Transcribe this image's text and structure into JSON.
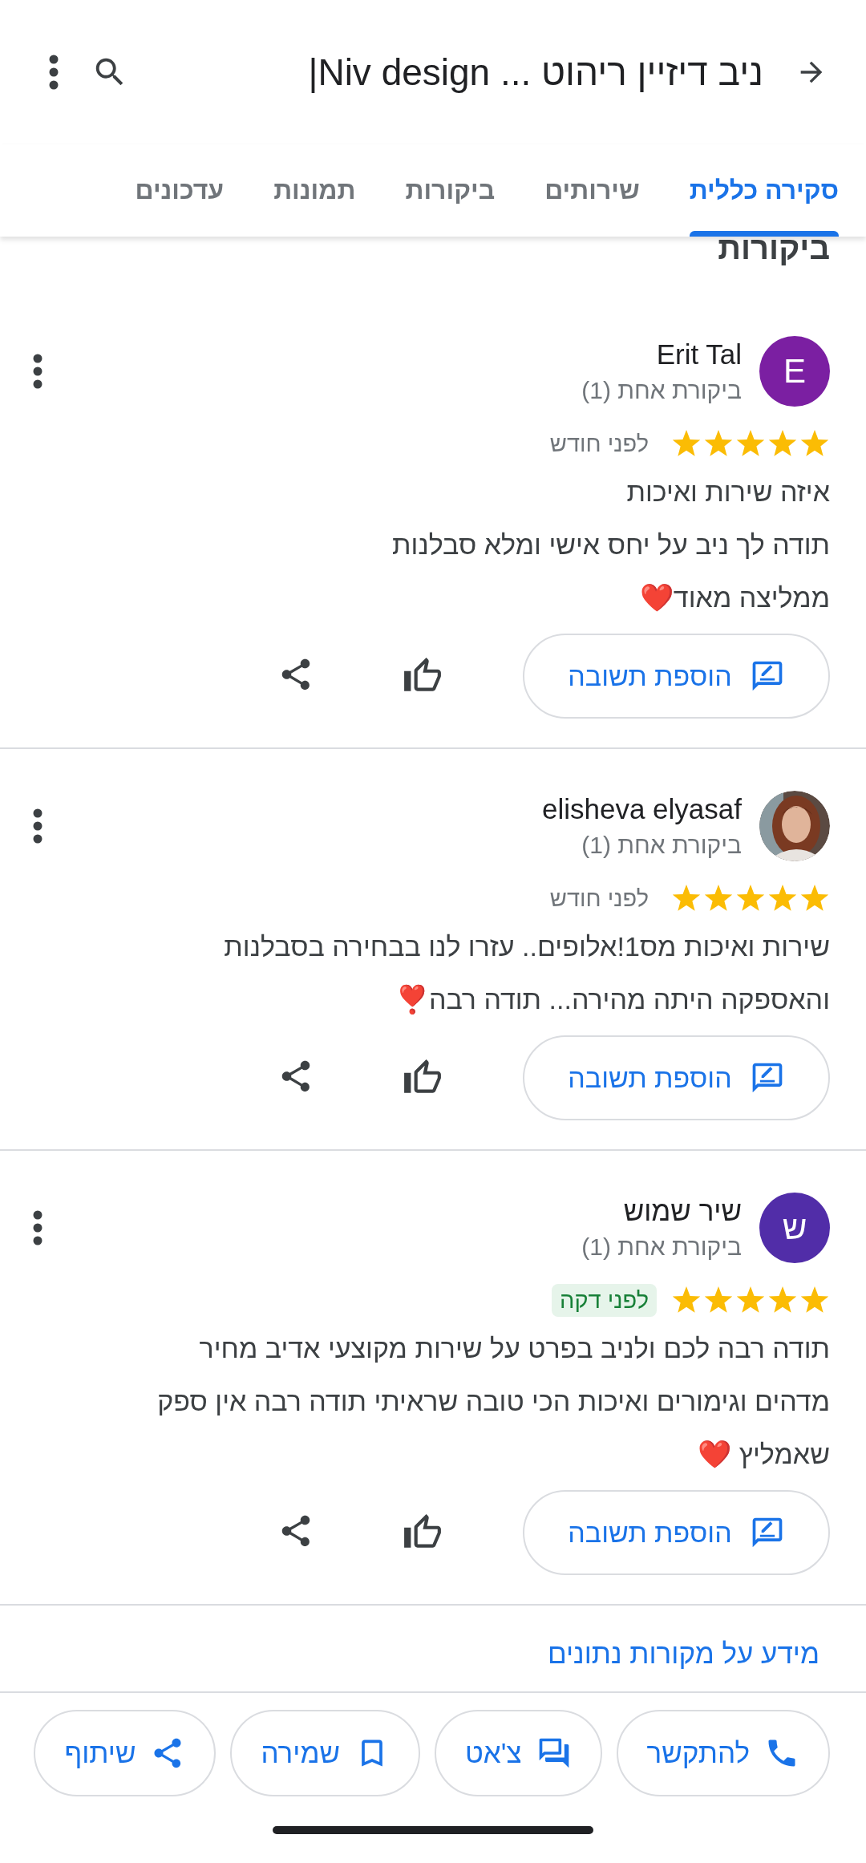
{
  "search_bar": {
    "query": "ניב דיזיין ריהוט ... Niv design|"
  },
  "tabs": [
    {
      "label": "סקירה כללית",
      "selected": true
    },
    {
      "label": "שירותים",
      "selected": false
    },
    {
      "label": "ביקורות",
      "selected": false
    },
    {
      "label": "תמונות",
      "selected": false
    },
    {
      "label": "עדכונים",
      "selected": false
    }
  ],
  "section_title": "ביקורות",
  "reviews": [
    {
      "avatar": {
        "kind": "letter",
        "letter": "E",
        "color": "#7b1fa2"
      },
      "name": "Erit Tal",
      "subtitle": "ביקורת אחת (1)",
      "stars": 5,
      "time": "לפני חודש",
      "time_highlighted": false,
      "lines": [
        "איזה שירות ואיכות",
        "תודה לך ניב על יחס אישי ומלא סבלנות",
        "ממליצה מאוד❤️"
      ],
      "reply_button": "הוספת תשובה"
    },
    {
      "avatar": {
        "kind": "picture"
      },
      "name": "elisheva elyasaf",
      "subtitle": "ביקורת אחת (1)",
      "stars": 5,
      "time": "לפני חודש",
      "time_highlighted": false,
      "lines": [
        "שירות ואיכות מס1!אלופים.. עזרו לנו בבחירה בסבלנות",
        "והאספקה היתה מהירה... תודה רבה❣️"
      ],
      "reply_button": "הוספת תשובה"
    },
    {
      "avatar": {
        "kind": "letter",
        "letter": "ש",
        "color": "#512da8"
      },
      "name": "שיר שמוש",
      "subtitle": "ביקורת אחת (1)",
      "stars": 5,
      "time": "לפני דקה",
      "time_highlighted": true,
      "lines": [
        "תודה רבה לכם ולניב בפרט על שירות מקוצעי אדיב מחיר",
        "מדהים וגימורים ואיכות הכי טובה שראיתי תודה רבה אין ספק",
        "שאמליץ ❤️"
      ],
      "reply_button": "הוספת תשובה"
    }
  ],
  "data_sources_link": "מידע על מקורות נתונים",
  "action_buttons": [
    {
      "kind": "call",
      "label": "להתקשר"
    },
    {
      "kind": "chat",
      "label": "צ'אט"
    },
    {
      "kind": "save",
      "label": "שמירה"
    },
    {
      "kind": "share",
      "label": "שיתוף"
    }
  ]
}
